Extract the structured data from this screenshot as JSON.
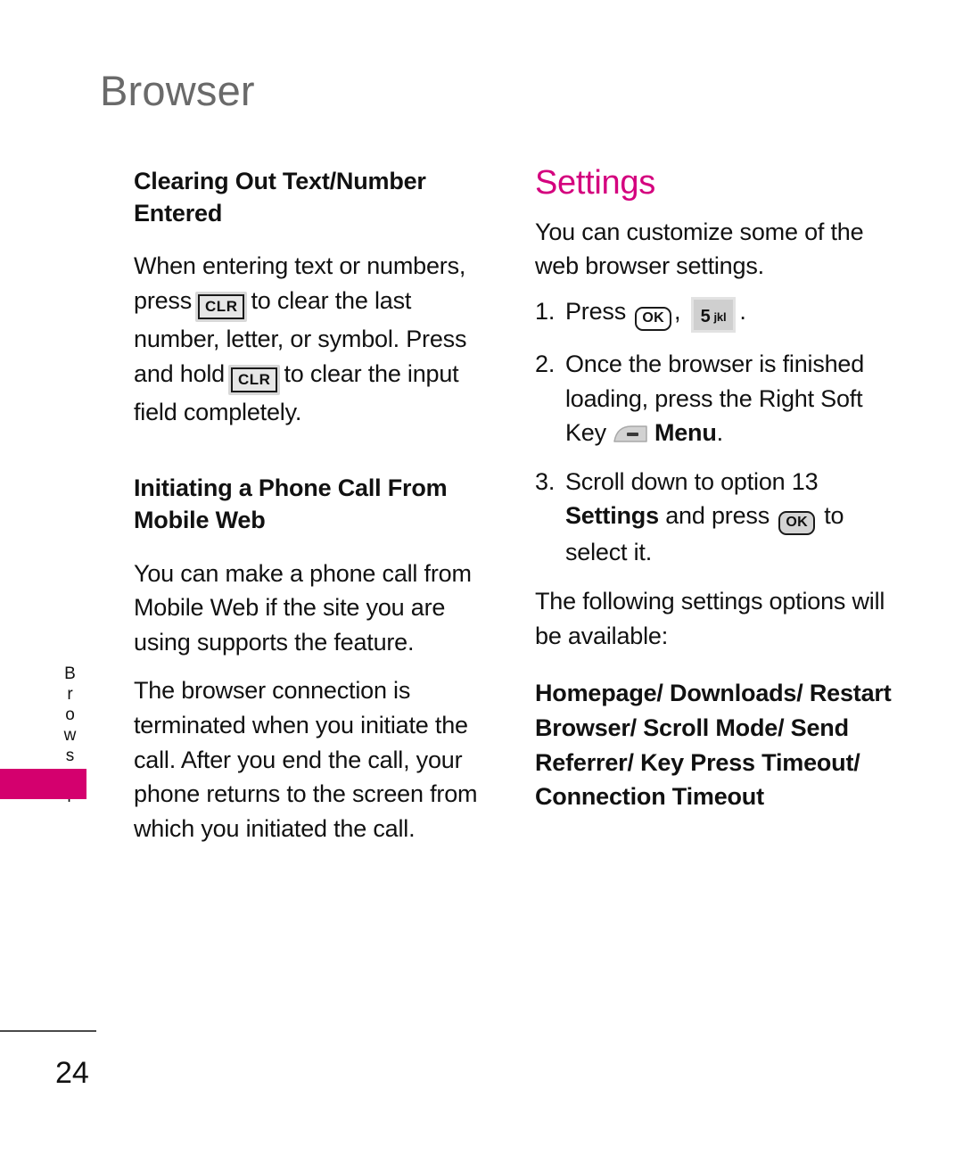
{
  "page": {
    "title": "Browser",
    "side_tab_label": "Browser",
    "page_number": "24",
    "accent_color": "#d4007e",
    "tab_color": "#d4006e",
    "title_color": "#6a6a6a"
  },
  "left_column": {
    "heading_1": "Clearing Out Text/Number Entered",
    "paragraph_1": {
      "part_1": "When entering text or numbers, press",
      "key_1": {
        "icon": "clr-key",
        "label": "CLR"
      },
      "part_2": "to clear the last number, letter, or symbol. Press and hold",
      "key_2": {
        "icon": "clr-key",
        "label": "CLR"
      },
      "part_3": "to clear the input field completely."
    },
    "heading_2": "Initiating a Phone Call From Mobile Web",
    "paragraph_2": "You can make a phone call from Mobile Web if the site you are using supports the feature.",
    "paragraph_3": "The browser connection is terminated when you initiate the call. After you end the call, your phone returns to the screen from which you initiated the call."
  },
  "right_column": {
    "heading": "Settings",
    "intro": "You can customize some of the web browser settings.",
    "steps": [
      {
        "number": "1.",
        "part_1": "Press",
        "key_1": {
          "icon": "ok-key",
          "label": "OK"
        },
        "separator": ",",
        "key_2": {
          "icon": "number-key-5",
          "number": "5",
          "letters": "jkl"
        },
        "part_2": "."
      },
      {
        "number": "2.",
        "part_1": "Once the browser is finished loading, press the Right Soft Key",
        "key_1": {
          "icon": "right-soft-key"
        },
        "bold_label": "Menu",
        "part_2": "."
      },
      {
        "number": "3.",
        "part_1": "Scroll down to option 13",
        "bold_label": "Settings",
        "part_2": "and press",
        "key_1": {
          "icon": "ok-key",
          "label": "OK"
        },
        "part_3": "to select it."
      }
    ],
    "closing_note": "The following settings options will be available:",
    "options": "Homepage/ Downloads/ Restart Browser/ Scroll Mode/ Send Referrer/ Key Press Timeout/ Connection Timeout"
  }
}
